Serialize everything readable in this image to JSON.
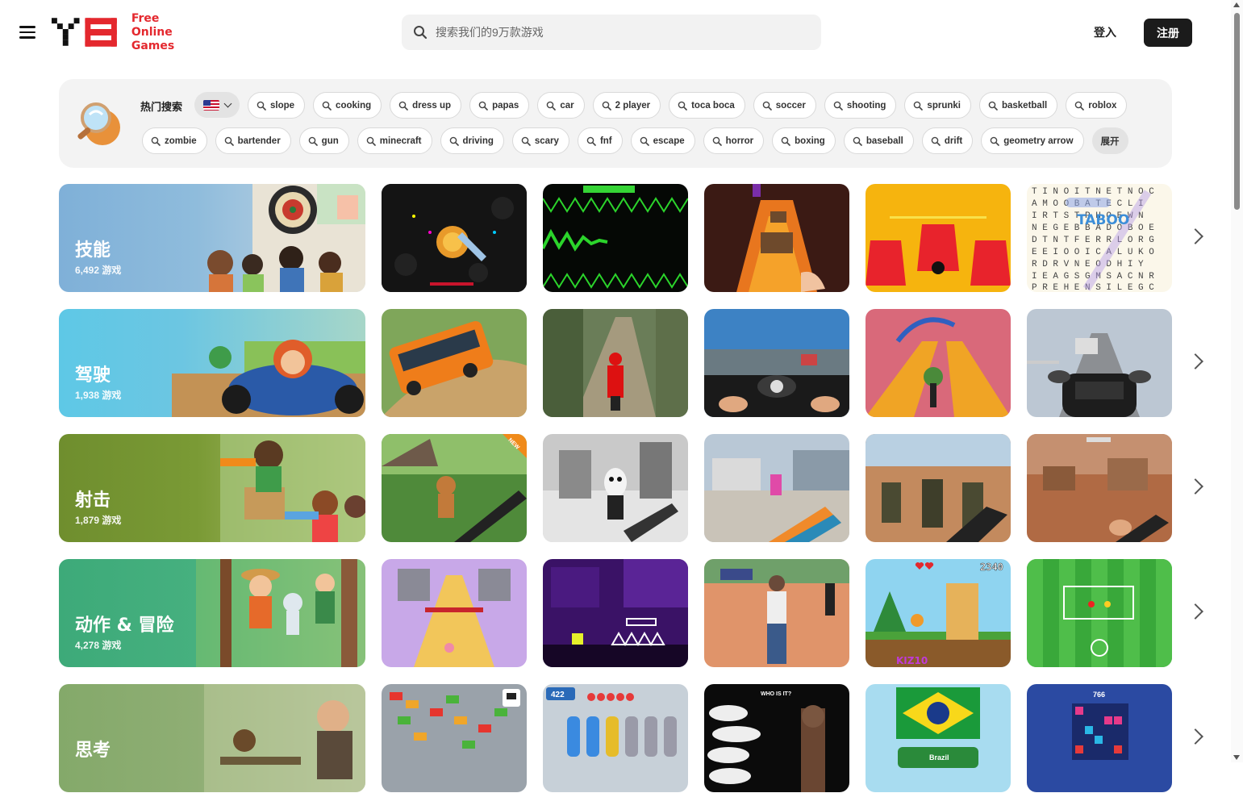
{
  "header": {
    "logo_text_line1": "Free Online",
    "logo_text_line2": "Games",
    "search_placeholder": "搜索我们的9万款游戏",
    "login_label": "登入",
    "register_label": "注册"
  },
  "hot_search": {
    "title": "热门搜索",
    "flag": "us-flag-icon",
    "row1": [
      "slope",
      "cooking",
      "dress up",
      "papas",
      "car",
      "2 player",
      "toca boca",
      "soccer",
      "shooting",
      "sprunki",
      "basketball",
      "roblox"
    ],
    "row2": [
      "zombie",
      "bartender",
      "gun",
      "minecraft",
      "driving",
      "scary",
      "fnf",
      "escape",
      "horror",
      "boxing",
      "baseball",
      "drift",
      "geometry arrow"
    ],
    "expand_label": "展开"
  },
  "categories": [
    {
      "name": "技能",
      "count": "6,492 游戏",
      "color": "#7fb0d8"
    },
    {
      "name": "驾驶",
      "count": "1,938 游戏",
      "color": "#5ec8e6"
    },
    {
      "name": "射击",
      "count": "1,879 游戏",
      "color": "#6f8e2e"
    },
    {
      "name": "动作 & 冒险",
      "count": "4,278 游戏",
      "color": "#3daa79"
    },
    {
      "name": "思考",
      "count": "",
      "color": "#84a96a"
    }
  ],
  "thumb_text": {
    "taboo": "TABOO",
    "score": "2340",
    "brand": "KIZ10",
    "new_badge": "NEW",
    "who_is_it": "WHO IS IT?",
    "brazil": "Brazil",
    "level": "766",
    "people": "422"
  }
}
